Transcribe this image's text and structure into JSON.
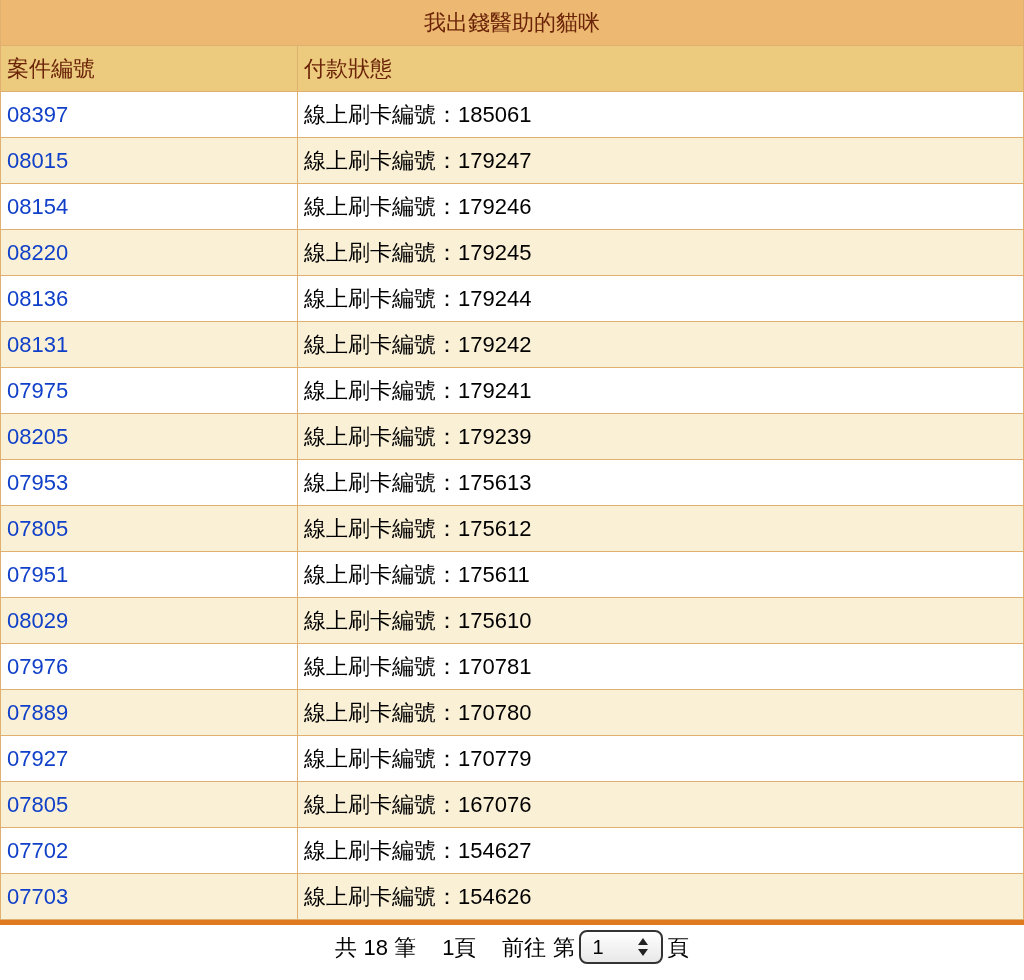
{
  "table": {
    "title": "我出錢醫助的貓咪",
    "columns": [
      "案件編號",
      "付款狀態"
    ],
    "rows": [
      {
        "case_no": "08397",
        "status": "線上刷卡編號：185061"
      },
      {
        "case_no": "08015",
        "status": "線上刷卡編號：179247"
      },
      {
        "case_no": "08154",
        "status": "線上刷卡編號：179246"
      },
      {
        "case_no": "08220",
        "status": "線上刷卡編號：179245"
      },
      {
        "case_no": "08136",
        "status": "線上刷卡編號：179244"
      },
      {
        "case_no": "08131",
        "status": "線上刷卡編號：179242"
      },
      {
        "case_no": "07975",
        "status": "線上刷卡編號：179241"
      },
      {
        "case_no": "08205",
        "status": "線上刷卡編號：179239"
      },
      {
        "case_no": "07953",
        "status": "線上刷卡編號：175613"
      },
      {
        "case_no": "07805",
        "status": "線上刷卡編號：175612"
      },
      {
        "case_no": "07951",
        "status": "線上刷卡編號：175611"
      },
      {
        "case_no": "08029",
        "status": "線上刷卡編號：175610"
      },
      {
        "case_no": "07976",
        "status": "線上刷卡編號：170781"
      },
      {
        "case_no": "07889",
        "status": "線上刷卡編號：170780"
      },
      {
        "case_no": "07927",
        "status": "線上刷卡編號：170779"
      },
      {
        "case_no": "07805",
        "status": "線上刷卡編號：167076"
      },
      {
        "case_no": "07702",
        "status": "線上刷卡編號：154627"
      },
      {
        "case_no": "07703",
        "status": "線上刷卡編號：154626"
      }
    ]
  },
  "pagination": {
    "total": "共 18 筆",
    "pages": "1頁",
    "goto": "前往 第",
    "page_select": "1",
    "suffix": "頁"
  }
}
